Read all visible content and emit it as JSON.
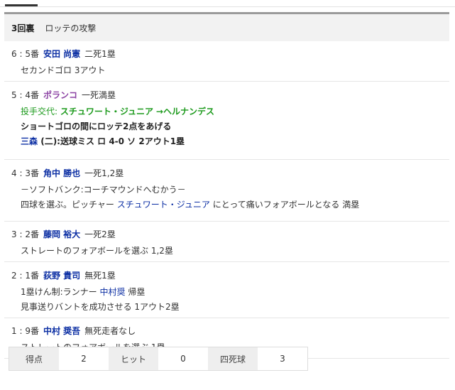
{
  "inning": {
    "number": "3回裏",
    "team": "ロッテの攻撃"
  },
  "plays": [
    {
      "seq": "6",
      "order": "5番",
      "batter": "安田 尚憲",
      "situation": "二死1塁",
      "lines": [
        {
          "text": "セカンドゴロ 3アウト"
        }
      ]
    },
    {
      "seq": "5",
      "order": "4番",
      "batter": "ポランコ",
      "situation": "一死満塁",
      "lines": [
        {
          "label": "投手交代:",
          "from": "スチュワート・ジュニア",
          "arrow": "→",
          "to": "ヘルナンデス"
        },
        {
          "text": "ショートゴロの間にロッテ2点をあげる"
        },
        {
          "runner": "三森",
          "rest": "(二):送球ミス ロ 4-0 ソ 2アウト1塁"
        }
      ]
    },
    {
      "seq": "4",
      "order": "3番",
      "batter": "角中 勝也",
      "situation": "一死1,2塁",
      "lines": [
        {
          "text": "－ソフトバンク:コーチマウンドへむかう－"
        },
        {
          "pre": "四球を選ぶ。ピッチャー",
          "link": "スチュワート・ジュニア",
          "post": "にとって痛いフォアボールとなる 満塁"
        }
      ]
    },
    {
      "seq": "3",
      "order": "2番",
      "batter": "藤岡 裕大",
      "situation": "一死2塁",
      "lines": [
        {
          "text": "ストレートのフォアボールを選ぶ 1,2塁"
        }
      ]
    },
    {
      "seq": "2",
      "order": "1番",
      "batter": "荻野 貴司",
      "situation": "無死1塁",
      "lines": [
        {
          "pre": "1塁けん制:ランナー",
          "link": "中村奨",
          "post": "帰塁"
        },
        {
          "text": "見事送りバントを成功させる 1アウト2塁"
        }
      ]
    },
    {
      "seq": "1",
      "order": "9番",
      "batter": "中村 奨吾",
      "situation": "無死走者なし",
      "lines": [
        {
          "text": "ストレートのフォアボールを選ぶ 1塁"
        }
      ]
    }
  ],
  "summary": {
    "runs_label": "得点",
    "runs": "2",
    "hits_label": "ヒット",
    "hits": "0",
    "walks_label": "四死球",
    "walks": "3"
  },
  "colors": {
    "player_link": "#0b2ea3",
    "foreign_player": "#8c44a4",
    "pitching_change": "#1c9a1c",
    "header_bar": "#9a9a9a"
  }
}
